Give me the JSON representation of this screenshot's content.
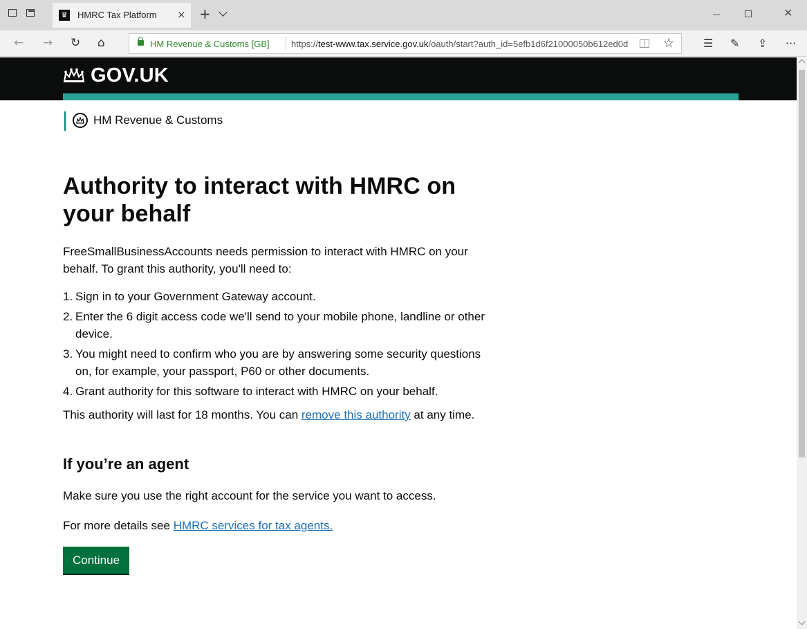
{
  "browser": {
    "tab_title": "HMRC Tax Platform",
    "favicon_glyph": "♛",
    "tab_close": "×",
    "new_tab": "+",
    "site_identity": "HM Revenue & Customs [GB]",
    "url_prefix": "https://",
    "url_host": "test-www.tax.service.gov.uk",
    "url_rest": "/oauth/start?auth_id=5efb1d6f21000050b612ed0d",
    "nav": {
      "back": "←",
      "forward": "→",
      "refresh": "↻",
      "home": "⌂"
    },
    "toolbar": {
      "favorite": "☆",
      "favorites_hub": "☰",
      "notes": "✎",
      "share": "⇪",
      "more": "···"
    },
    "window_close": "✕"
  },
  "header": {
    "logo_text": "GOV.UK",
    "accent_color": "#28a197"
  },
  "organisation": {
    "name": "HM Revenue & Customs"
  },
  "main": {
    "title": "Authority to interact with HMRC on your behalf",
    "intro": "FreeSmallBusinessAccounts needs permission to interact with HMRC on your behalf. To grant this authority, you'll need to:",
    "steps": [
      {
        "num": "1.",
        "text": "Sign in to your Government Gateway account."
      },
      {
        "num": "2.",
        "text": "Enter the 6 digit access code we'll send to your mobile phone, landline or other device."
      },
      {
        "num": "3.",
        "text": "You might need to confirm who you are by answering some security questions on, for example, your passport, P60 or other documents."
      },
      {
        "num": "4.",
        "text": "Grant authority for this software to interact with HMRC on your behalf."
      }
    ],
    "duration_before": "This authority will last for 18 months. You can ",
    "remove_link": "remove this authority",
    "duration_after": " at any time.",
    "agent_heading": "If you’re an agent",
    "agent_text": "Make sure you use the right account for the service you want to access.",
    "details_before": "For more details see ",
    "agents_link": "HMRC services for tax agents.",
    "continue_label": "Continue",
    "button_color": "#00703c",
    "link_color": "#1d70b8"
  }
}
